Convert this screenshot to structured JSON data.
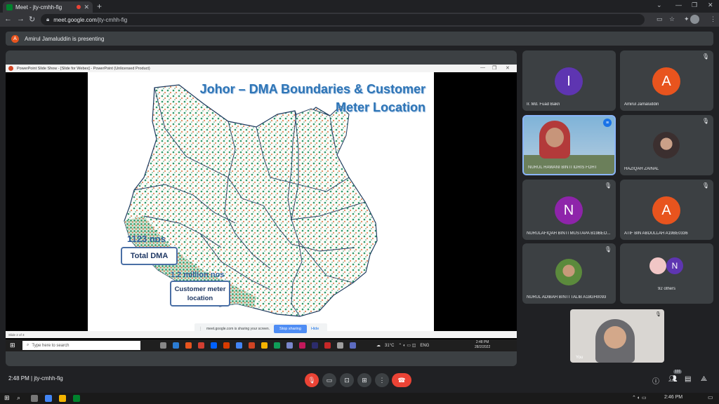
{
  "browser": {
    "tab_title": "Meet - jty-cmhh-fig",
    "new_tab": "+",
    "url_host": "meet.google.com",
    "url_path": "/jty-cmhh-fig"
  },
  "banner": {
    "avatar_letter": "A",
    "text": "Amirul Jamaluddin is presenting"
  },
  "ppt_window": {
    "title": "PowerPoint Slide Show - [Slide for Webex] - PowerPoint (Unlicensed Product)",
    "status": "Slide 2 of 3"
  },
  "slide": {
    "title_line1": "Johor – DMA Boundaries & Customer",
    "title_line2": "Meter Location",
    "dma_count": "1123 nos",
    "dma_label": "Total DMA",
    "meter_count": "1.2 million nos",
    "meter_label_line1": "Customer meter",
    "meter_label_line2": "location"
  },
  "share_bar": {
    "message": "meet.google.com is sharing your screen.",
    "stop": "Stop sharing",
    "hide": "Hide"
  },
  "inner_taskbar": {
    "search_placeholder": "Type here to search",
    "weather": "31°C",
    "lang": "ENG",
    "time": "2:48 PM",
    "date": "28/2/2022"
  },
  "participants": [
    {
      "name": "Ir. Md. Fuad Bakri",
      "letter": "I",
      "color": "#5e35b1"
    },
    {
      "name": "Amirul Jamaluddin",
      "letter": "A",
      "color": "#e8541e"
    },
    {
      "name": "NURUL HAWANI BINTI IDRIS FOHT"
    },
    {
      "name": "HAZIQAH ZAINAL"
    },
    {
      "name": "NURULAFIQAH BINTI MUSTAPA B19BEO...",
      "letter": "N",
      "color": "#8e24aa"
    },
    {
      "name": "ATIF BIN ABDULLAH A19BE0336",
      "letter": "A",
      "color": "#e8541e"
    },
    {
      "name": "NURUL ADIBAH BINTI TALIB A18GH0093"
    },
    {
      "name": "92 others",
      "letter": "N",
      "color": "#5e35b1"
    }
  ],
  "self_tile": {
    "label": "You"
  },
  "bottom": {
    "time": "2:48 PM",
    "separator": "|",
    "meeting_code": "jty-cmhh-fig",
    "participant_count": "101"
  },
  "os": {
    "time": "2:46 PM"
  }
}
